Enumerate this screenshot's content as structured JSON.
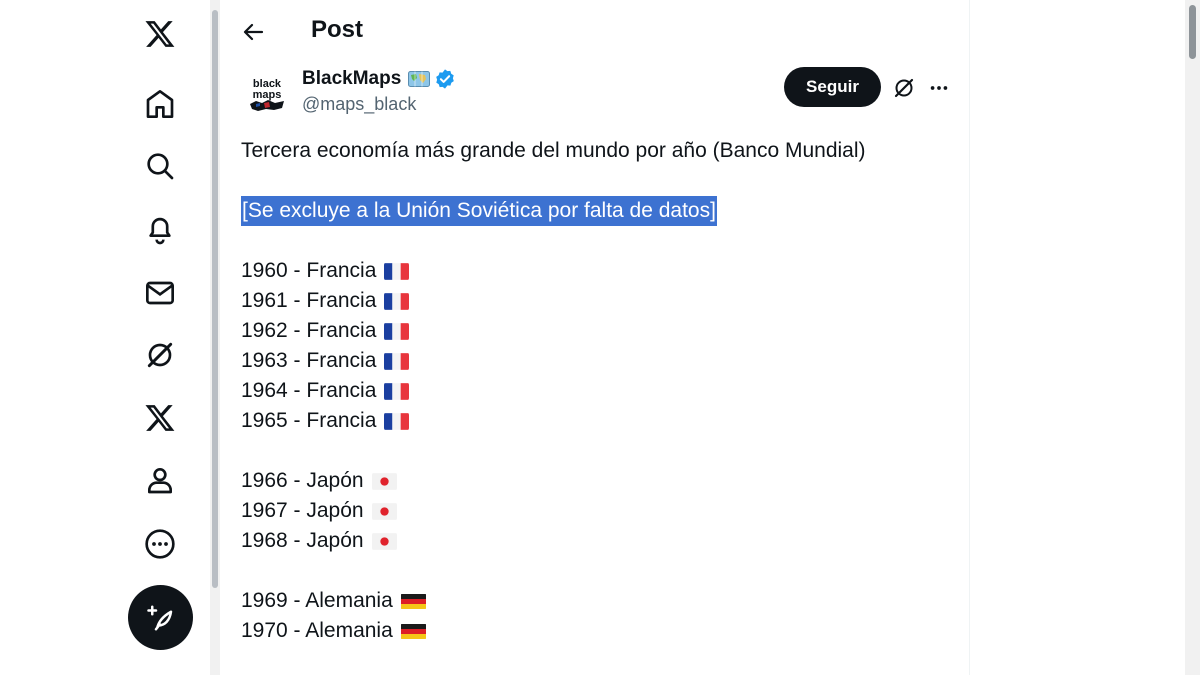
{
  "header": {
    "title": "Post",
    "back_icon": "arrow-left-icon"
  },
  "nav": {
    "items": [
      {
        "name": "x-logo",
        "icon": "x-logo-icon"
      },
      {
        "name": "home",
        "icon": "home-icon"
      },
      {
        "name": "explore",
        "icon": "search-icon"
      },
      {
        "name": "notifications",
        "icon": "bell-icon"
      },
      {
        "name": "messages",
        "icon": "mail-icon"
      },
      {
        "name": "grok",
        "icon": "grok-icon"
      },
      {
        "name": "premium",
        "icon": "x-icon"
      },
      {
        "name": "profile",
        "icon": "person-icon"
      },
      {
        "name": "more",
        "icon": "more-circle-icon"
      }
    ],
    "compose_icon": "feather-plus-icon"
  },
  "post": {
    "author_name": "BlackMaps",
    "author_handle": "@maps_black",
    "follow_label": "Seguir",
    "text_line1": "Tercera economía más grande del mundo por año (Banco Mundial)",
    "highlighted_line": "[Se excluye a la Unión Soviética por falta de datos]",
    "entries": [
      {
        "text": "1960 - Francia",
        "flag": "fr"
      },
      {
        "text": "1961 - Francia",
        "flag": "fr"
      },
      {
        "text": "1962 - Francia",
        "flag": "fr"
      },
      {
        "text": "1963 - Francia",
        "flag": "fr"
      },
      {
        "text": "1964 - Francia",
        "flag": "fr"
      },
      {
        "text": "1965 - Francia",
        "flag": "fr"
      },
      {
        "text": "1966 - Japón",
        "flag": "jp"
      },
      {
        "text": "1967 - Japón",
        "flag": "jp"
      },
      {
        "text": "1968 - Japón",
        "flag": "jp"
      },
      {
        "text": "1969 - Alemania",
        "flag": "de"
      },
      {
        "text": "1970 - Alemania",
        "flag": "de"
      }
    ]
  },
  "colors": {
    "text": "#0f1419",
    "muted": "#536471",
    "verified": "#1d9bf0",
    "selection": "#3d72d1"
  }
}
